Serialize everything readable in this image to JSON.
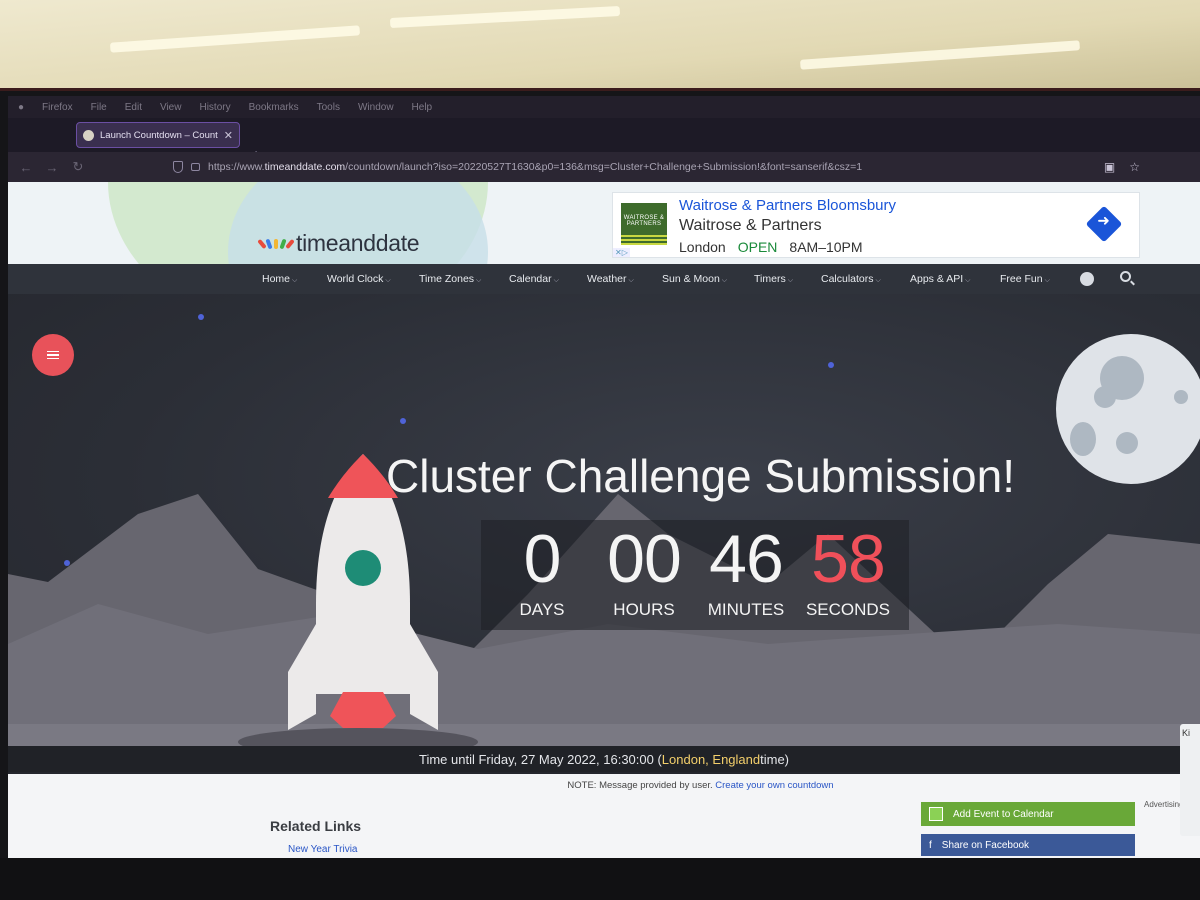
{
  "browser": {
    "menu": [
      "Firefox",
      "File",
      "Edit",
      "View",
      "History",
      "Bookmarks",
      "Tools",
      "Window",
      "Help"
    ],
    "tab_title": "Launch Countdown – Countdown",
    "tab_close": "✕",
    "new_tab": "+",
    "url_prefix": "https://www.",
    "url_domain": "timeanddate.com",
    "url_path": "/countdown/launch?iso=20220527T1630&p0=136&msg=Cluster+Challenge+Submission!&font=sanserif&csz=1"
  },
  "site": {
    "logo_text": "timeanddate",
    "ad": {
      "title": "Waitrose & Partners Bloomsbury",
      "subtitle": "Waitrose & Partners",
      "city": "London",
      "status": "OPEN",
      "hours": "8AM–10PM",
      "logo_text": "WAITROSE & PARTNERS"
    },
    "nav": [
      "Home",
      "World Clock",
      "Time Zones",
      "Calendar",
      "Weather",
      "Sun & Moon",
      "Timers",
      "Calculators",
      "Apps & API",
      "Free Fun"
    ]
  },
  "countdown": {
    "title": "Cluster Challenge Submission!",
    "units": [
      {
        "value": "0",
        "label": "DAYS"
      },
      {
        "value": "00",
        "label": "HOURS"
      },
      {
        "value": "46",
        "label": "MINUTES"
      },
      {
        "value": "58",
        "label": "SECONDS"
      }
    ],
    "time_until_prefix": "Time until Friday, 27 May 2022, 16:30:00 (",
    "location": "London, England",
    "time_until_suffix": " time)"
  },
  "content": {
    "note": "NOTE: Message provided by user.",
    "note_link": "Create your own countdown",
    "related_title": "Related Links",
    "related_item": "New Year Trivia",
    "add_event": "Add Event to Calendar",
    "share": "Share on Facebook",
    "advertising": "Advertising",
    "side_popup": "Ki"
  },
  "colors": {
    "accent_red": "#f0505a",
    "menu_button": "#e8525a",
    "nav_bg": "#2f333b",
    "calendar_green": "#69a838",
    "facebook_blue": "#3b5998"
  }
}
